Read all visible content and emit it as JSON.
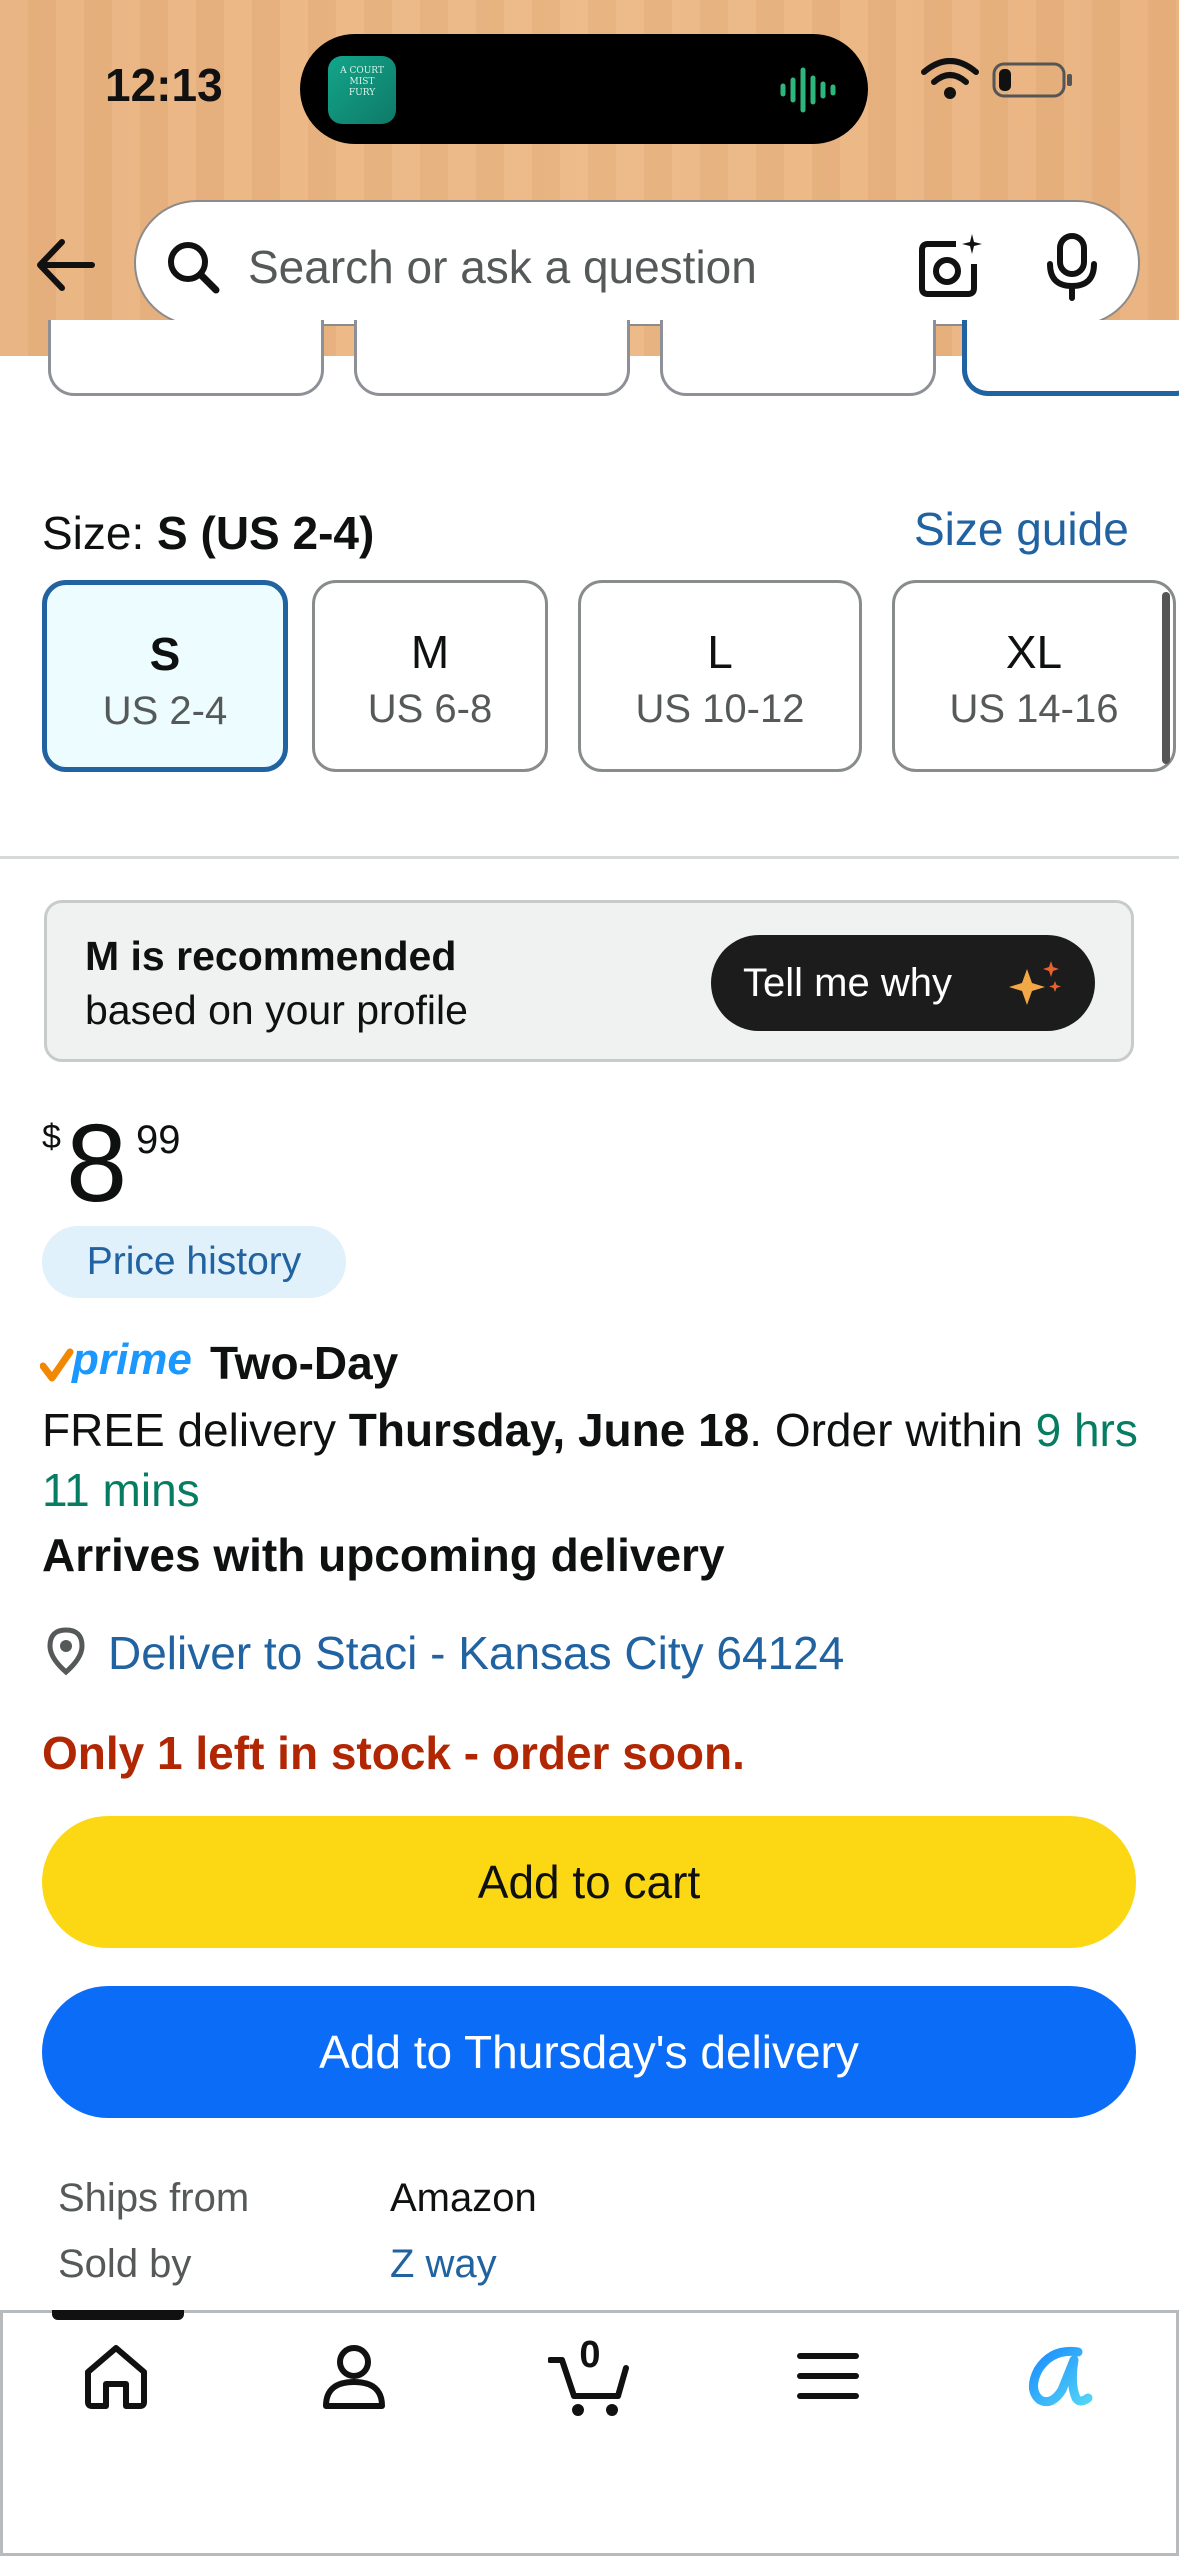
{
  "status_bar": {
    "time": "12:13"
  },
  "search": {
    "placeholder": "Search or ask a question"
  },
  "size": {
    "label": "Size: ",
    "selected": "S (US 2-4)",
    "guide_link": "Size guide",
    "options": [
      {
        "main": "S",
        "sub": "US 2-4"
      },
      {
        "main": "M",
        "sub": "US 6-8"
      },
      {
        "main": "L",
        "sub": "US 10-12"
      },
      {
        "main": "XL",
        "sub": "US 14-16"
      }
    ]
  },
  "recommendation": {
    "title": "M is recommended",
    "subtitle": "based on your profile",
    "button": "Tell me why"
  },
  "price": {
    "currency": "$",
    "whole": "8",
    "fraction": "99"
  },
  "price_history": "Price history",
  "delivery": {
    "prime_label": "prime",
    "prime_speed": "Two-Day",
    "free_prefix": "FREE delivery ",
    "date": "Thursday, June 18",
    "order_within_prefix": ". Order within ",
    "countdown": "9 hrs 11 mins",
    "arrives_note": "Arrives with upcoming delivery",
    "deliver_to": "Deliver to Staci - Kansas City 64124"
  },
  "stock_warning": "Only 1 left in stock - order soon.",
  "buttons": {
    "add_to_cart": "Add to cart",
    "add_to_delivery": "Add to Thursday's delivery"
  },
  "seller": {
    "ships_from_label": "Ships from",
    "ships_from_value": "Amazon",
    "sold_by_label": "Sold by",
    "sold_by_value": "Z way"
  },
  "nav": {
    "cart_count": "0"
  },
  "colors": {
    "header_bg": "#ecb884",
    "link_blue": "#2162a1",
    "cart_yellow": "#fcd814",
    "delivery_blue": "#0a6cf7",
    "stock_red": "#b12704",
    "countdown_green": "#067d62"
  }
}
